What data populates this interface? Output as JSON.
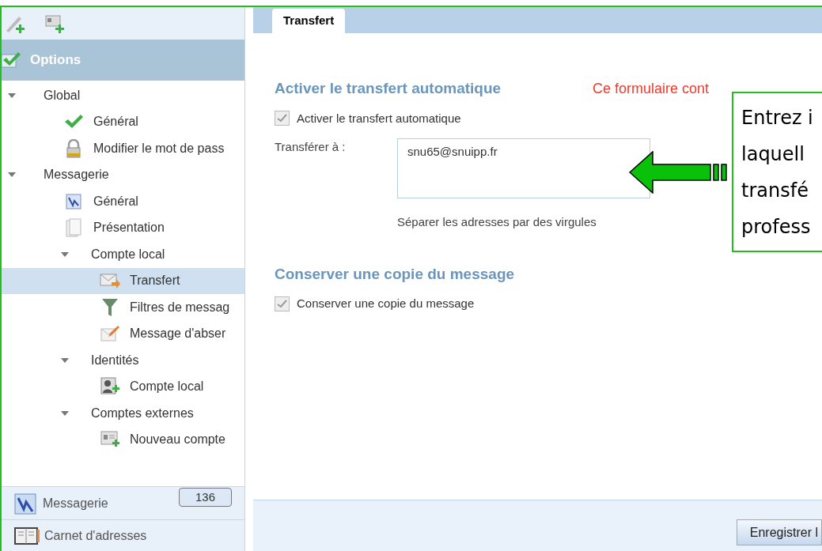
{
  "sidebar": {
    "title": "Options",
    "tree": [
      {
        "label": "Global",
        "expanded": true,
        "children": [
          {
            "label": "Général",
            "selected": false
          },
          {
            "label": "Modifier le mot de pass",
            "selected": false
          }
        ]
      },
      {
        "label": "Messagerie",
        "expanded": true,
        "children": [
          {
            "label": "Général",
            "selected": false
          },
          {
            "label": "Présentation",
            "selected": false
          },
          {
            "label": "Compte local",
            "expanded": true,
            "children": [
              {
                "label": "Transfert",
                "selected": true
              },
              {
                "label": "Filtres de messag",
                "selected": false
              },
              {
                "label": "Message d'abser",
                "selected": false
              }
            ]
          },
          {
            "label": "Identités",
            "expanded": true,
            "children": [
              {
                "label": "Compte local",
                "selected": false
              }
            ]
          },
          {
            "label": "Comptes externes",
            "expanded": true,
            "children": [
              {
                "label": "Nouveau compte",
                "selected": false
              }
            ]
          }
        ]
      }
    ],
    "nav": [
      {
        "label": "Messagerie",
        "badge": "136"
      },
      {
        "label": "Carnet d'adresses"
      }
    ]
  },
  "tabs": [
    {
      "label": "Transfert",
      "selected": true
    }
  ],
  "sections": [
    {
      "heading": "Activer le transfert automatique",
      "notice": "Ce formulaire cont",
      "checkbox": {
        "label": "Activer le transfert automatique",
        "checked": true
      },
      "field": {
        "label": "Transférer à :",
        "value": "snu65@snuipp.fr",
        "hint": "Séparer les adresses par des virgules"
      }
    },
    {
      "heading": "Conserver une copie du message",
      "checkbox": {
        "label": "Conserver une copie du message",
        "checked": true
      }
    }
  ],
  "footer": {
    "button": "Enregistrer l"
  },
  "callout": {
    "lines": [
      "Entrez i",
      "laquell",
      "transfé",
      "profess"
    ]
  }
}
